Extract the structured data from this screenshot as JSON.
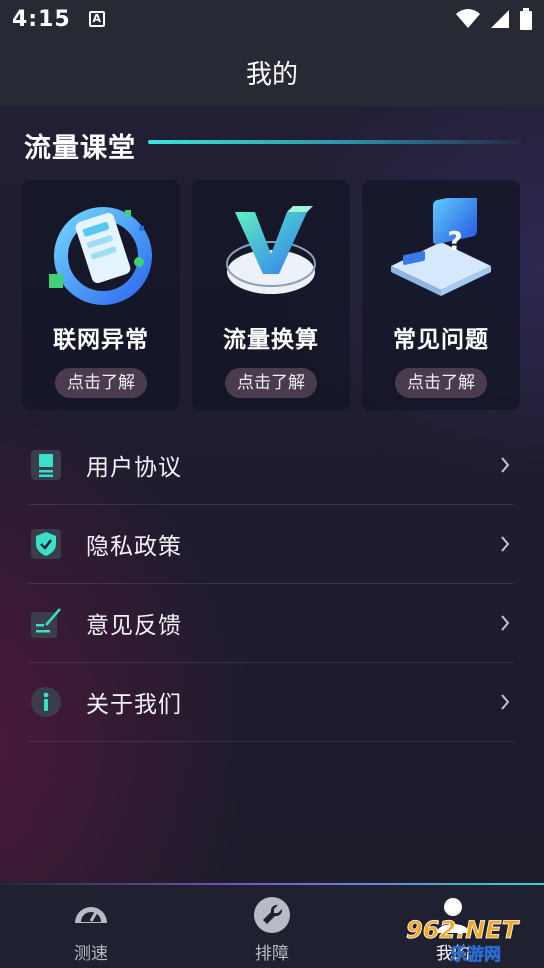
{
  "status_bar": {
    "time": "4:15",
    "notification_icon": "a-notification-icon",
    "wifi_icon": "wifi-icon",
    "signal_icon": "signal-icon",
    "battery_icon": "battery-icon"
  },
  "app_bar": {
    "title": "我的"
  },
  "section": {
    "title": "流量课堂"
  },
  "cards": [
    {
      "name": "联网异常",
      "button": "点击了解",
      "icon": "phone-network-icon"
    },
    {
      "name": "流量换算",
      "button": "点击了解",
      "icon": "v-logo-icon"
    },
    {
      "name": "常见问题",
      "button": "点击了解",
      "icon": "question-screen-icon"
    }
  ],
  "menu": [
    {
      "label": "用户协议",
      "icon": "document-icon"
    },
    {
      "label": "隐私政策",
      "icon": "shield-check-icon"
    },
    {
      "label": "意见反馈",
      "icon": "feedback-edit-icon"
    },
    {
      "label": "关于我们",
      "icon": "info-icon"
    }
  ],
  "bottom_nav": [
    {
      "label": "测速",
      "icon": "speedometer-icon"
    },
    {
      "label": "排障",
      "icon": "wrench-icon"
    },
    {
      "label": "我的",
      "icon": "user-icon"
    }
  ],
  "watermark": {
    "text": "962.NET",
    "subtext": "乐游网"
  },
  "colors": {
    "accent": "#3be6e0",
    "card_button": "#4a3c4e",
    "background": "#1c1c2c"
  }
}
